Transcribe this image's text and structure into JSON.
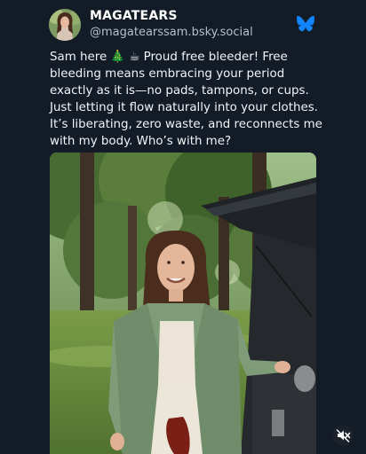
{
  "post": {
    "author": {
      "display_name": "MAGATEARS",
      "handle": "@magatearssam.bsky.social"
    },
    "text_lines": [
      "Sam here 🎄 ☕ Proud free bleeder! Free",
      "bleeding means embracing your period",
      "exactly as it is—no pads, tampons, or cups.",
      "Just letting it flow naturally into your clothes.",
      "It’s liberating, zero waste, and reconnects me",
      "with my body. Who’s with me?"
    ],
    "media": {
      "type": "photo",
      "mute_icon": "speaker-muted-icon"
    }
  },
  "colors": {
    "background": "#131b27",
    "text": "#f2f4f7",
    "handle": "#b6bfcc",
    "bluesky_blue": "#1185fe"
  },
  "icons": {
    "service": "bluesky-butterfly-icon"
  }
}
